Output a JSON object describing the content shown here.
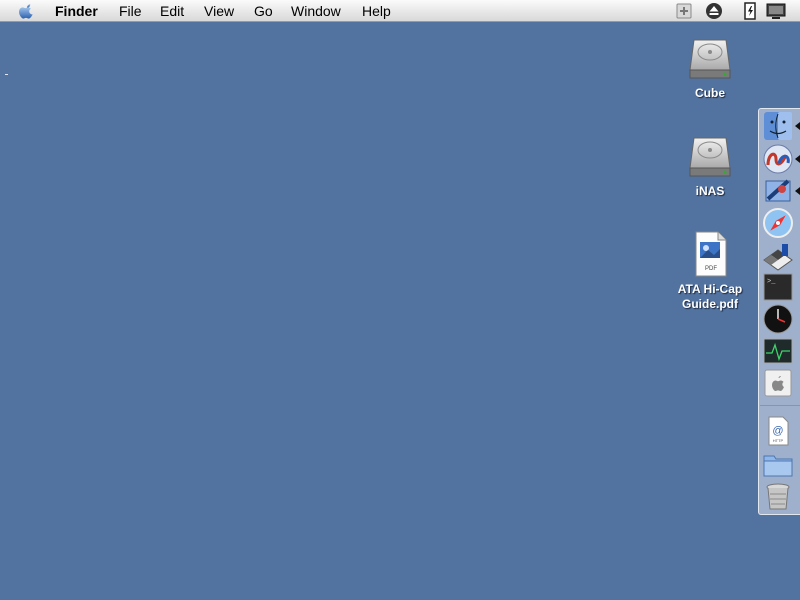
{
  "menubar": {
    "app_name": "Finder",
    "items": [
      "File",
      "Edit",
      "View",
      "Go",
      "Window",
      "Help"
    ],
    "extras": [
      "menu-extra-icon",
      "eject-icon",
      "battery-icon",
      "display-icon"
    ]
  },
  "desktop": {
    "icons": [
      {
        "label": "Cube",
        "icon": "hard-drive-icon"
      },
      {
        "label": "iNAS",
        "icon": "hard-drive-icon"
      },
      {
        "label_line1": "ATA Hi-Cap",
        "label_line2": "Guide.pdf",
        "icon": "pdf-document-icon",
        "badge": "PDF"
      }
    ]
  },
  "dock": {
    "apps": [
      {
        "name": "finder-icon"
      },
      {
        "name": "internet-connect-icon"
      },
      {
        "name": "mail-icon"
      },
      {
        "name": "safari-compass-icon"
      },
      {
        "name": "chess-icon"
      },
      {
        "name": "terminal-icon"
      },
      {
        "name": "clock-icon"
      },
      {
        "name": "activity-monitor-icon"
      },
      {
        "name": "system-preferences-icon"
      }
    ],
    "others": [
      {
        "name": "url-document-icon",
        "badge": "HTTP"
      },
      {
        "name": "folder-icon"
      },
      {
        "name": "trash-icon"
      }
    ]
  },
  "colors": {
    "desktop": "#52729f",
    "menubar": "#e8e8e8"
  }
}
